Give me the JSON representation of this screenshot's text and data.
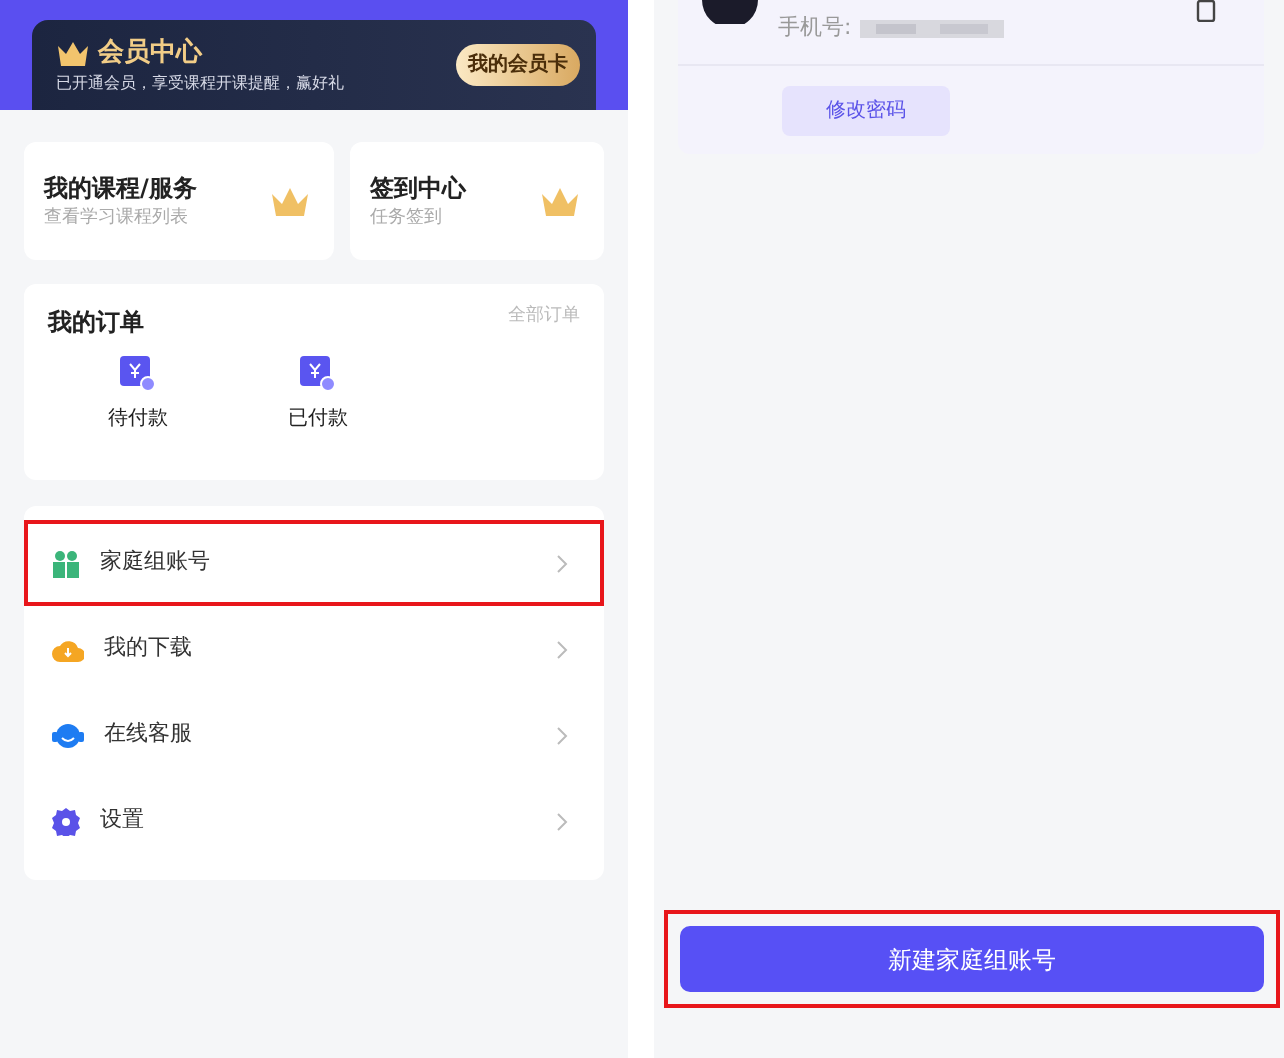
{
  "member": {
    "title": "会员中心",
    "subtitle": "已开通会员，享受课程开课提醒，赢好礼",
    "button": "我的会员卡"
  },
  "shortcuts": [
    {
      "title": "我的课程/服务",
      "subtitle": "查看学习课程列表"
    },
    {
      "title": "签到中心",
      "subtitle": "任务签到"
    }
  ],
  "orders": {
    "title": "我的订单",
    "link": "全部订单",
    "items": [
      "待付款",
      "已付款"
    ]
  },
  "menu": [
    {
      "label": "家庭组账号",
      "kind": "family",
      "highlighted": true
    },
    {
      "label": "我的下载",
      "kind": "download",
      "highlighted": false
    },
    {
      "label": "在线客服",
      "kind": "service",
      "highlighted": false
    },
    {
      "label": "设置",
      "kind": "settings",
      "highlighted": false
    }
  ],
  "account": {
    "phone_label": "手机号:",
    "change_password": "修改密码"
  },
  "create_button": {
    "label": "新建家庭组账号",
    "highlighted": true
  }
}
